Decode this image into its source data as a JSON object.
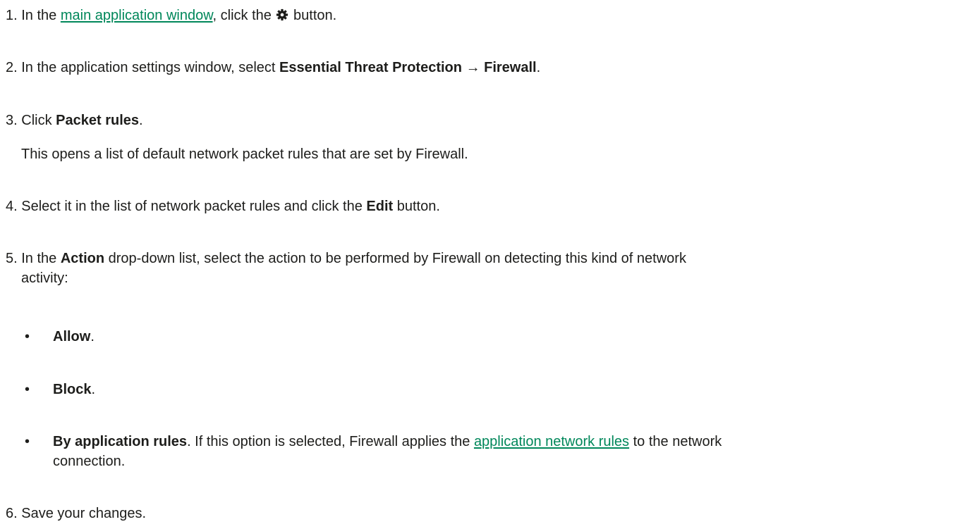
{
  "steps": {
    "s1": {
      "num": "1.",
      "pre": "In the",
      "link": "main application window",
      "mid": ", click the",
      "icon": "gear-icon",
      "post": "button."
    },
    "s2": {
      "num": "2.",
      "pre": "In the application settings window, select",
      "bold1": "Essential Threat Protection",
      "arrow": "→",
      "bold2": "Firewall",
      "post": "."
    },
    "s3": {
      "num": "3.",
      "pre": "Click",
      "bold": "Packet rules",
      "post": ".",
      "note": "This opens a list of default network packet rules that are set by Firewall."
    },
    "s4": {
      "num": "4.",
      "pre": "Select it in the list of network packet rules and click the",
      "bold": "Edit",
      "post": "button."
    },
    "s5": {
      "num": "5.",
      "pre": "In the",
      "bold": "Action",
      "post": "drop-down list, select the action to be performed by Firewall on detecting this kind of network",
      "cont": "activity:",
      "options": [
        {
          "bold": "Allow",
          "rest": "."
        },
        {
          "bold": "Block",
          "rest": "."
        },
        {
          "bold": "By application rules",
          "rest": ". If this option is selected, Firewall applies the",
          "link": "application network rules",
          "tail": "to the network",
          "cont": "connection."
        }
      ]
    },
    "s6": {
      "num": "6.",
      "text": "Save your changes."
    }
  },
  "colors": {
    "text": "#1d1d1b",
    "link": "#00875a"
  }
}
